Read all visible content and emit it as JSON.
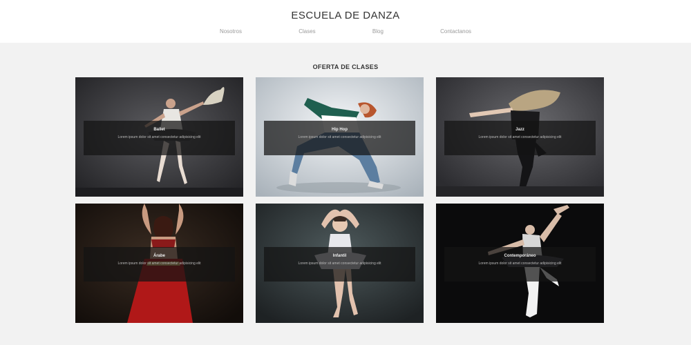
{
  "header": {
    "title": "ESCUELA DE DANZA",
    "nav": [
      "Nosotros",
      "Clases",
      "Blog",
      "Contactanos"
    ]
  },
  "section": {
    "title": "OFERTA DE CLASES"
  },
  "cards": [
    {
      "title": "Ballet",
      "description": "Lorem ipsum dolor sit amet consectetur adipisicing elit",
      "photo": "ballet-dancer-with-fan"
    },
    {
      "title": "Hip Hop",
      "description": "Lorem ipsum dolor sit amet consectetur adipisicing elit",
      "photo": "hip-hop-dancer-jumping"
    },
    {
      "title": "Jazz",
      "description": "Lorem ipsum dolor sit amet consectetur adipisicing elit",
      "photo": "jazz-dancer-hair-flip"
    },
    {
      "title": "Árabe",
      "description": "Lorem ipsum dolor sit amet consectetur adipisicing elit",
      "photo": "belly-dancer-red-skirt"
    },
    {
      "title": "Infantil",
      "description": "Lorem ipsum dolor sit amet consectetur adipisicing elit",
      "photo": "child-ballerina"
    },
    {
      "title": "Contemporáneo",
      "description": "Lorem ipsum dolor sit amet consectetur adipisicing elit",
      "photo": "contemporary-dancer-leaning"
    }
  ],
  "colors": {
    "page_background": "#f2f2f2",
    "header_background": "#ffffff",
    "overlay": "#141414"
  }
}
